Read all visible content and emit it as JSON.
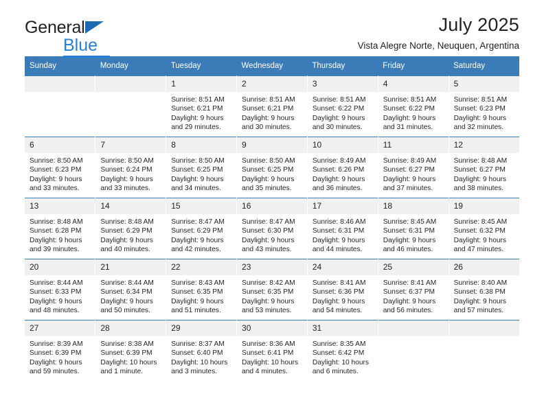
{
  "brand": {
    "name_part1": "General",
    "name_part2": "Blue",
    "triangle_color": "#1d6cb3",
    "blue_color": "#2980d4"
  },
  "header": {
    "title": "July 2025",
    "location": "Vista Alegre Norte, Neuquen, Argentina"
  },
  "theme": {
    "header_blue": "#3b7cb8",
    "daynum_gray": "#f0f0f0",
    "text_color": "#231f20"
  },
  "weekday_headers": [
    "Sunday",
    "Monday",
    "Tuesday",
    "Wednesday",
    "Thursday",
    "Friday",
    "Saturday"
  ],
  "weeks": [
    [
      {
        "day": "",
        "lines": []
      },
      {
        "day": "",
        "lines": []
      },
      {
        "day": "1",
        "lines": [
          "Sunrise: 8:51 AM",
          "Sunset: 6:21 PM",
          "Daylight: 9 hours",
          "and 29 minutes."
        ]
      },
      {
        "day": "2",
        "lines": [
          "Sunrise: 8:51 AM",
          "Sunset: 6:21 PM",
          "Daylight: 9 hours",
          "and 30 minutes."
        ]
      },
      {
        "day": "3",
        "lines": [
          "Sunrise: 8:51 AM",
          "Sunset: 6:22 PM",
          "Daylight: 9 hours",
          "and 30 minutes."
        ]
      },
      {
        "day": "4",
        "lines": [
          "Sunrise: 8:51 AM",
          "Sunset: 6:22 PM",
          "Daylight: 9 hours",
          "and 31 minutes."
        ]
      },
      {
        "day": "5",
        "lines": [
          "Sunrise: 8:51 AM",
          "Sunset: 6:23 PM",
          "Daylight: 9 hours",
          "and 32 minutes."
        ]
      }
    ],
    [
      {
        "day": "6",
        "lines": [
          "Sunrise: 8:50 AM",
          "Sunset: 6:23 PM",
          "Daylight: 9 hours",
          "and 33 minutes."
        ]
      },
      {
        "day": "7",
        "lines": [
          "Sunrise: 8:50 AM",
          "Sunset: 6:24 PM",
          "Daylight: 9 hours",
          "and 33 minutes."
        ]
      },
      {
        "day": "8",
        "lines": [
          "Sunrise: 8:50 AM",
          "Sunset: 6:25 PM",
          "Daylight: 9 hours",
          "and 34 minutes."
        ]
      },
      {
        "day": "9",
        "lines": [
          "Sunrise: 8:50 AM",
          "Sunset: 6:25 PM",
          "Daylight: 9 hours",
          "and 35 minutes."
        ]
      },
      {
        "day": "10",
        "lines": [
          "Sunrise: 8:49 AM",
          "Sunset: 6:26 PM",
          "Daylight: 9 hours",
          "and 36 minutes."
        ]
      },
      {
        "day": "11",
        "lines": [
          "Sunrise: 8:49 AM",
          "Sunset: 6:27 PM",
          "Daylight: 9 hours",
          "and 37 minutes."
        ]
      },
      {
        "day": "12",
        "lines": [
          "Sunrise: 8:48 AM",
          "Sunset: 6:27 PM",
          "Daylight: 9 hours",
          "and 38 minutes."
        ]
      }
    ],
    [
      {
        "day": "13",
        "lines": [
          "Sunrise: 8:48 AM",
          "Sunset: 6:28 PM",
          "Daylight: 9 hours",
          "and 39 minutes."
        ]
      },
      {
        "day": "14",
        "lines": [
          "Sunrise: 8:48 AM",
          "Sunset: 6:29 PM",
          "Daylight: 9 hours",
          "and 40 minutes."
        ]
      },
      {
        "day": "15",
        "lines": [
          "Sunrise: 8:47 AM",
          "Sunset: 6:29 PM",
          "Daylight: 9 hours",
          "and 42 minutes."
        ]
      },
      {
        "day": "16",
        "lines": [
          "Sunrise: 8:47 AM",
          "Sunset: 6:30 PM",
          "Daylight: 9 hours",
          "and 43 minutes."
        ]
      },
      {
        "day": "17",
        "lines": [
          "Sunrise: 8:46 AM",
          "Sunset: 6:31 PM",
          "Daylight: 9 hours",
          "and 44 minutes."
        ]
      },
      {
        "day": "18",
        "lines": [
          "Sunrise: 8:45 AM",
          "Sunset: 6:31 PM",
          "Daylight: 9 hours",
          "and 46 minutes."
        ]
      },
      {
        "day": "19",
        "lines": [
          "Sunrise: 8:45 AM",
          "Sunset: 6:32 PM",
          "Daylight: 9 hours",
          "and 47 minutes."
        ]
      }
    ],
    [
      {
        "day": "20",
        "lines": [
          "Sunrise: 8:44 AM",
          "Sunset: 6:33 PM",
          "Daylight: 9 hours",
          "and 48 minutes."
        ]
      },
      {
        "day": "21",
        "lines": [
          "Sunrise: 8:44 AM",
          "Sunset: 6:34 PM",
          "Daylight: 9 hours",
          "and 50 minutes."
        ]
      },
      {
        "day": "22",
        "lines": [
          "Sunrise: 8:43 AM",
          "Sunset: 6:35 PM",
          "Daylight: 9 hours",
          "and 51 minutes."
        ]
      },
      {
        "day": "23",
        "lines": [
          "Sunrise: 8:42 AM",
          "Sunset: 6:35 PM",
          "Daylight: 9 hours",
          "and 53 minutes."
        ]
      },
      {
        "day": "24",
        "lines": [
          "Sunrise: 8:41 AM",
          "Sunset: 6:36 PM",
          "Daylight: 9 hours",
          "and 54 minutes."
        ]
      },
      {
        "day": "25",
        "lines": [
          "Sunrise: 8:41 AM",
          "Sunset: 6:37 PM",
          "Daylight: 9 hours",
          "and 56 minutes."
        ]
      },
      {
        "day": "26",
        "lines": [
          "Sunrise: 8:40 AM",
          "Sunset: 6:38 PM",
          "Daylight: 9 hours",
          "and 57 minutes."
        ]
      }
    ],
    [
      {
        "day": "27",
        "lines": [
          "Sunrise: 8:39 AM",
          "Sunset: 6:39 PM",
          "Daylight: 9 hours",
          "and 59 minutes."
        ]
      },
      {
        "day": "28",
        "lines": [
          "Sunrise: 8:38 AM",
          "Sunset: 6:39 PM",
          "Daylight: 10 hours",
          "and 1 minute."
        ]
      },
      {
        "day": "29",
        "lines": [
          "Sunrise: 8:37 AM",
          "Sunset: 6:40 PM",
          "Daylight: 10 hours",
          "and 3 minutes."
        ]
      },
      {
        "day": "30",
        "lines": [
          "Sunrise: 8:36 AM",
          "Sunset: 6:41 PM",
          "Daylight: 10 hours",
          "and 4 minutes."
        ]
      },
      {
        "day": "31",
        "lines": [
          "Sunrise: 8:35 AM",
          "Sunset: 6:42 PM",
          "Daylight: 10 hours",
          "and 6 minutes."
        ]
      },
      {
        "day": "",
        "lines": []
      },
      {
        "day": "",
        "lines": []
      }
    ]
  ]
}
